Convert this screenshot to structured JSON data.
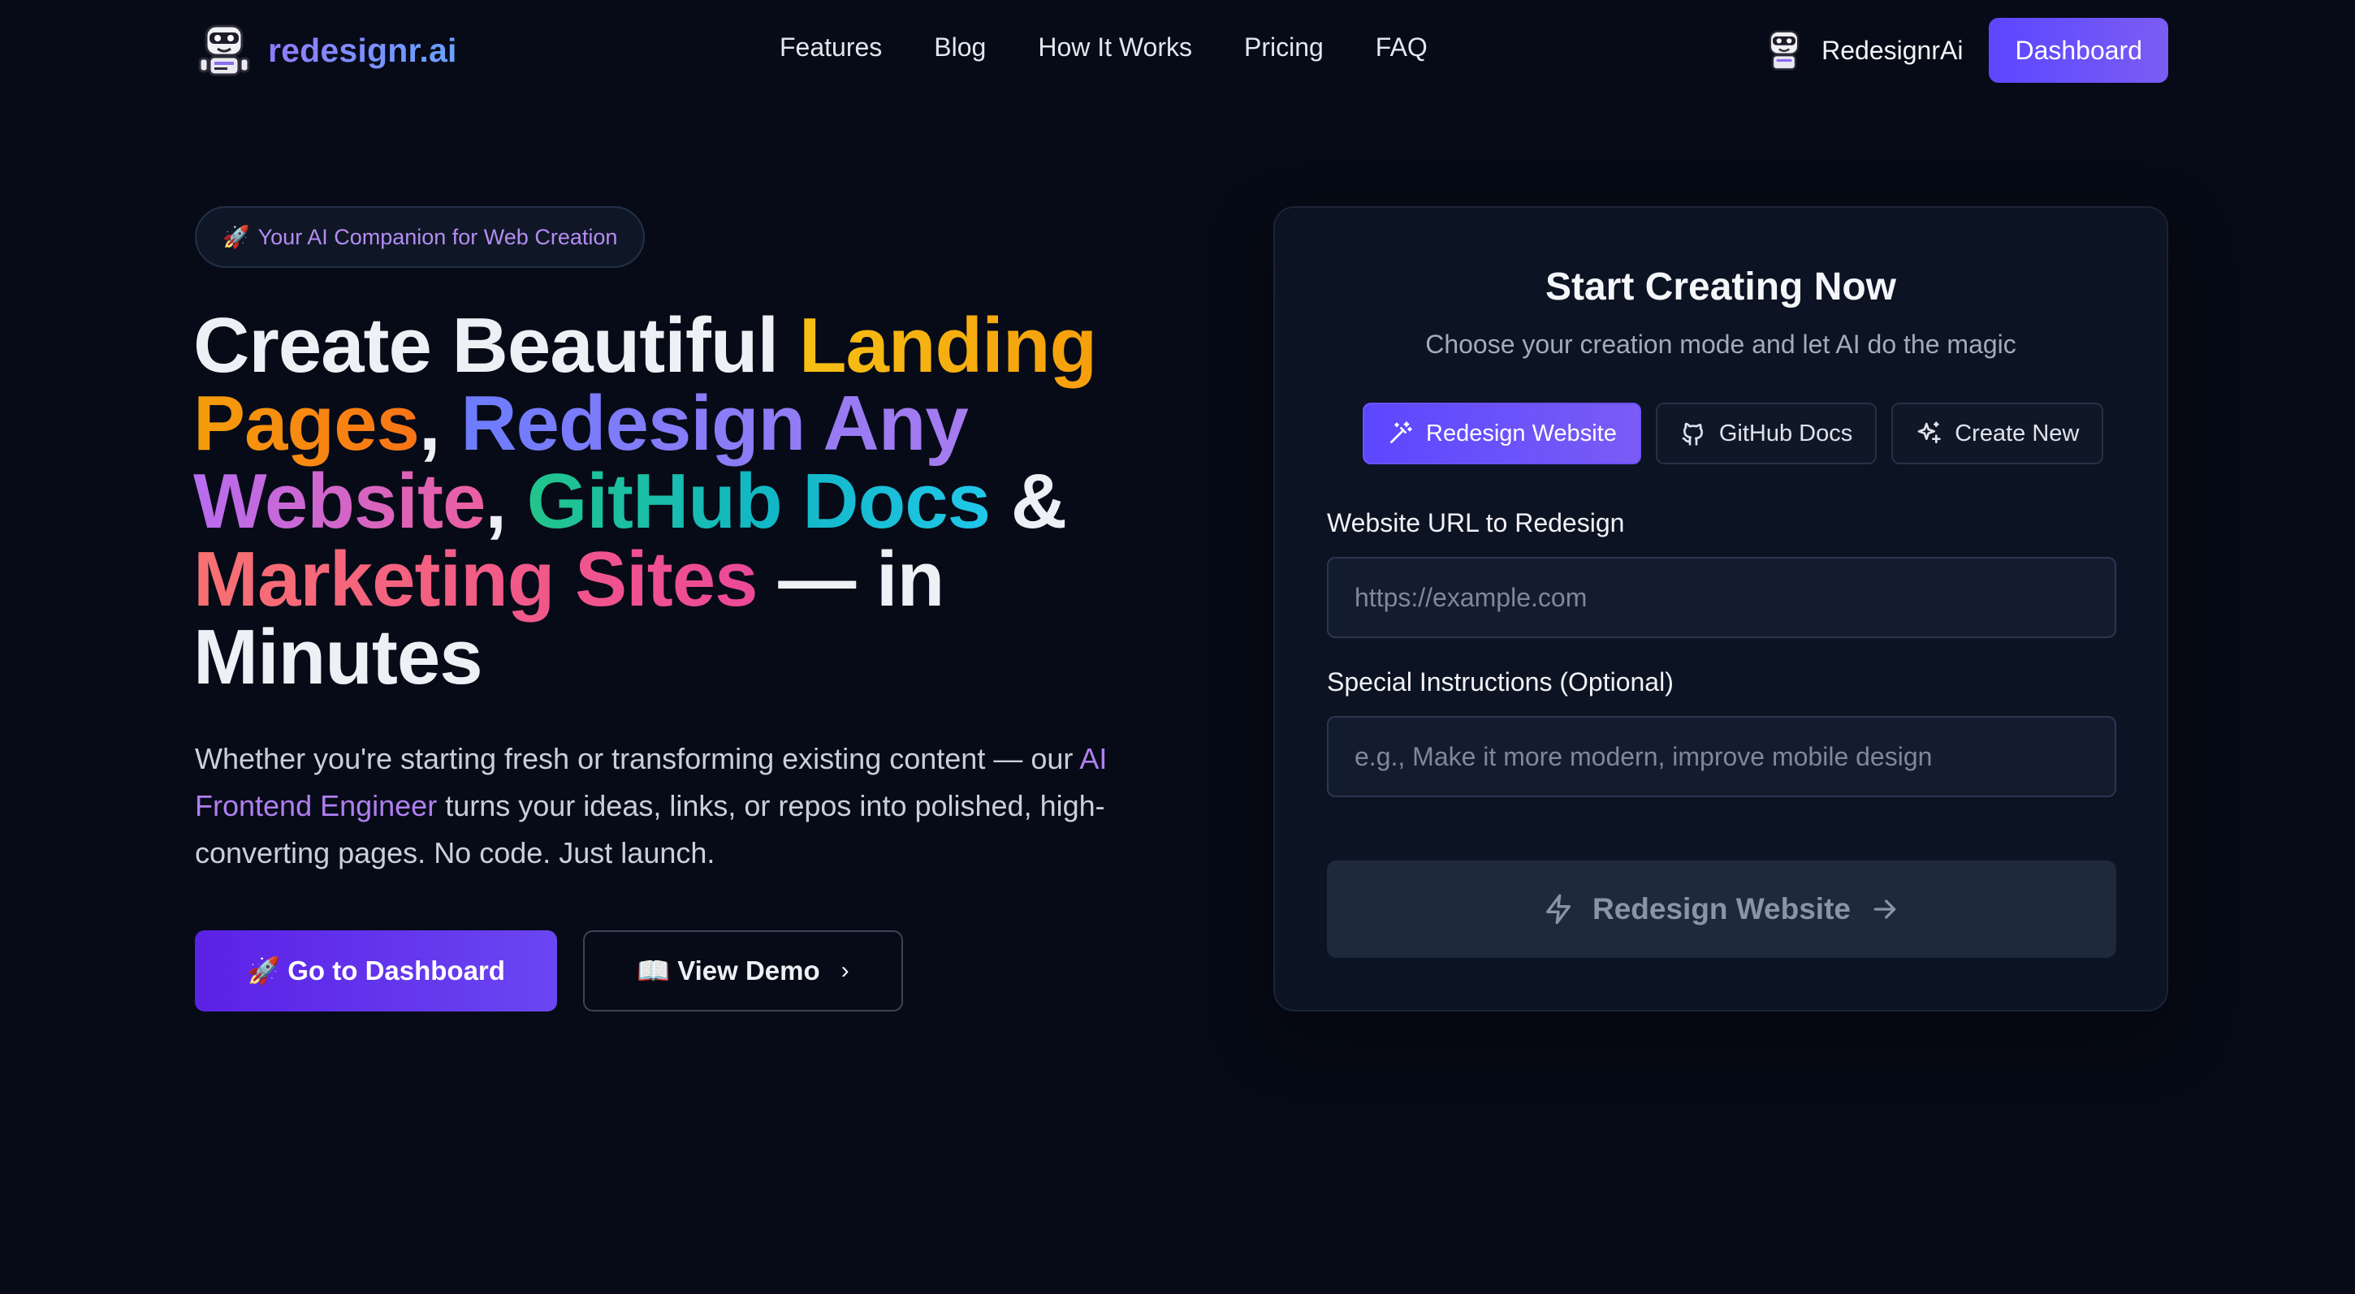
{
  "nav": {
    "brand": "redesignr.ai",
    "links": [
      "Features",
      "Blog",
      "How It Works",
      "Pricing",
      "FAQ"
    ],
    "user_name": "RedesignrAi",
    "dashboard_label": "Dashboard"
  },
  "hero": {
    "badge_emoji": "🚀",
    "badge_text": "Your AI Companion for Web Creation",
    "headline": {
      "part1": "Create Beautiful ",
      "landing": "Landing",
      "pages": "Pages",
      "comma1": ", ",
      "redesign": "Redesign Any",
      "website": "Website",
      "comma2": ", ",
      "github": "GitHub",
      "docs": "Docs",
      "amp": " & ",
      "marketing": "Marketing Sites",
      "tail": " — in Minutes"
    },
    "subtext": {
      "before": "Whether you're starting fresh or transforming existing content — our ",
      "accent": "AI Frontend Engineer",
      "after": " turns your ideas, links, or repos into polished, high-converting pages. No code. Just launch."
    },
    "cta_primary": "🚀 Go to Dashboard",
    "cta_secondary": "📖 View Demo",
    "cta_secondary_chevron": "›"
  },
  "card": {
    "title": "Start Creating Now",
    "subtitle": "Choose your creation mode and let AI do the magic",
    "modes": [
      {
        "label": "Redesign Website",
        "icon": "magic-wand-icon",
        "active": true
      },
      {
        "label": "GitHub Docs",
        "icon": "github-icon",
        "active": false
      },
      {
        "label": "Create New",
        "icon": "sparkles-icon",
        "active": false
      }
    ],
    "url_label": "Website URL to Redesign",
    "url_placeholder": "https://example.com",
    "url_value": "",
    "instructions_label": "Special Instructions (Optional)",
    "instructions_placeholder": "e.g., Make it more modern, improve mobile design",
    "instructions_value": "",
    "submit_label": "Redesign Website"
  },
  "colors": {
    "background": "#070b17",
    "accent": "#5b47ff",
    "card_bg": "#0c1322"
  }
}
